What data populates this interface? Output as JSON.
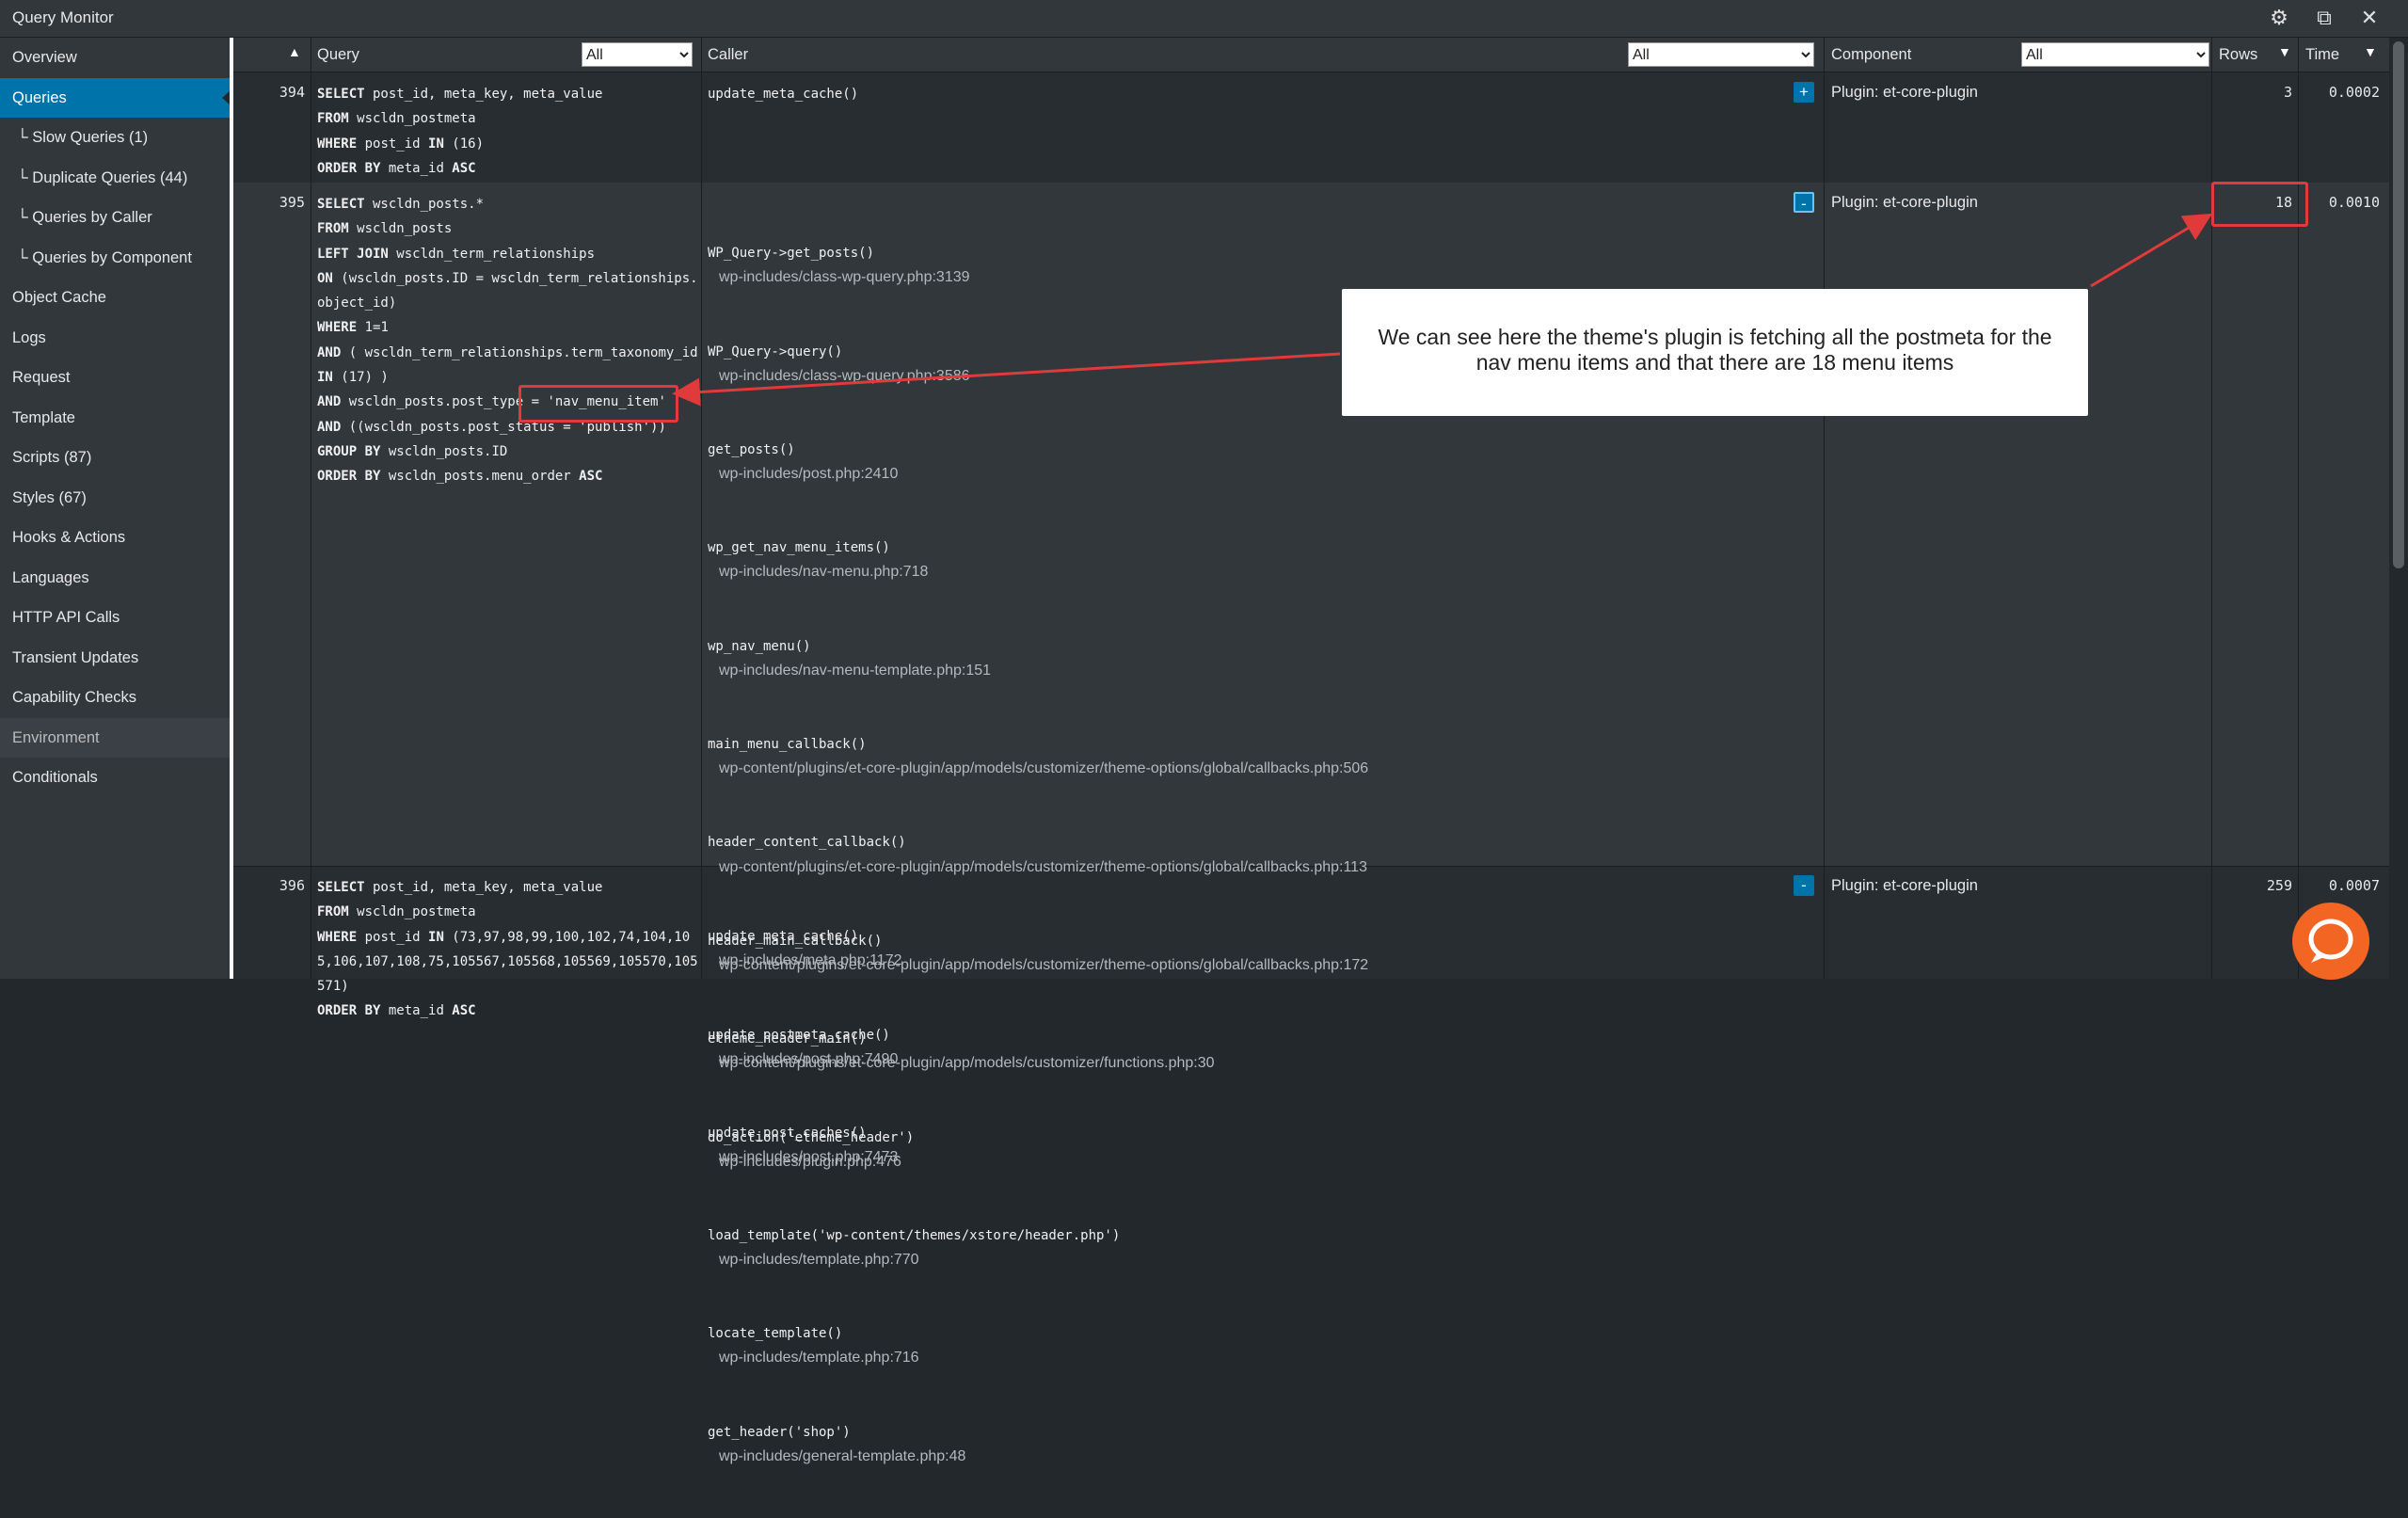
{
  "title": "Query Monitor",
  "sidebar": {
    "items": [
      {
        "label": "Overview"
      },
      {
        "label": "Queries"
      },
      {
        "label": "└ Slow Queries (1)"
      },
      {
        "label": "└ Duplicate Queries (44)"
      },
      {
        "label": "└ Queries by Caller"
      },
      {
        "label": "└ Queries by Component"
      },
      {
        "label": "Object Cache"
      },
      {
        "label": "Logs"
      },
      {
        "label": "Request"
      },
      {
        "label": "Template"
      },
      {
        "label": "Scripts (87)"
      },
      {
        "label": "Styles (67)"
      },
      {
        "label": "Hooks & Actions"
      },
      {
        "label": "Languages"
      },
      {
        "label": "HTTP API Calls"
      },
      {
        "label": "Transient Updates"
      },
      {
        "label": "Capability Checks"
      },
      {
        "label": "Environment"
      },
      {
        "label": "Conditionals"
      }
    ]
  },
  "header": {
    "query": "Query",
    "caller": "Caller",
    "component": "Component",
    "rows": "Rows",
    "time": "Time",
    "filter_all": "All"
  },
  "rows": [
    {
      "num": "394",
      "sql": [
        "SELECT post_id, meta_key, meta_value",
        "FROM wscldn_postmeta",
        "WHERE post_id IN (16)",
        "ORDER BY meta_id ASC"
      ],
      "callers": [
        {
          "fn": "update_meta_cache()"
        }
      ],
      "toggle": "+",
      "component": "Plugin: et-core-plugin",
      "rows": "3",
      "time": "0.0002"
    },
    {
      "num": "395",
      "sql": [
        "SELECT wscldn_posts.*",
        "FROM wscldn_posts",
        "LEFT JOIN wscldn_term_relationships",
        "ON (wscldn_posts.ID = wscldn_term_relationships.",
        "object_id)",
        "WHERE 1=1",
        "AND ( wscldn_term_relationships.term_taxonomy_id",
        "IN (17) )",
        "AND wscldn_posts.post_type = 'nav_menu_item'",
        "AND ((wscldn_posts.post_status = 'publish'))",
        "GROUP BY wscldn_posts.ID",
        "ORDER BY wscldn_posts.menu_order ASC"
      ],
      "callers": [
        {
          "fn": "WP_Query->get_posts()",
          "path": "wp-includes/class-wp-query.php:3139"
        },
        {
          "fn": "WP_Query->query()",
          "path": "wp-includes/class-wp-query.php:3586"
        },
        {
          "fn": "get_posts()",
          "path": "wp-includes/post.php:2410"
        },
        {
          "fn": "wp_get_nav_menu_items()",
          "path": "wp-includes/nav-menu.php:718"
        },
        {
          "fn": "wp_nav_menu()",
          "path": "wp-includes/nav-menu-template.php:151"
        },
        {
          "fn": "main_menu_callback()",
          "path": "wp-content/plugins/et-core-plugin/app/models/customizer/theme-options/global/callbacks.php:506"
        },
        {
          "fn": "header_content_callback()",
          "path": "wp-content/plugins/et-core-plugin/app/models/customizer/theme-options/global/callbacks.php:113"
        },
        {
          "fn": "header_main_callback()",
          "path": "wp-content/plugins/et-core-plugin/app/models/customizer/theme-options/global/callbacks.php:172"
        },
        {
          "fn": "etheme_header_main()",
          "path": "wp-content/plugins/et-core-plugin/app/models/customizer/functions.php:30"
        },
        {
          "fn": "do_action('etheme_header')",
          "path": "wp-includes/plugin.php:476"
        },
        {
          "fn": "load_template('wp-content/themes/xstore/header.php')",
          "path": "wp-includes/template.php:770"
        },
        {
          "fn": "locate_template()",
          "path": "wp-includes/template.php:716"
        },
        {
          "fn": "get_header('shop')",
          "path": "wp-includes/general-template.php:48"
        }
      ],
      "toggle": "-",
      "component": "Plugin: et-core-plugin",
      "rows": "18",
      "time": "0.0010"
    },
    {
      "num": "396",
      "sql": [
        "SELECT post_id, meta_key, meta_value",
        "FROM wscldn_postmeta",
        "WHERE post_id IN (73,97,98,99,100,102,74,104,10",
        "5,106,107,108,75,105567,105568,105569,105570,105",
        "571)",
        "ORDER BY meta_id ASC"
      ],
      "callers": [
        {
          "fn": "update_meta_cache()",
          "path": "wp-includes/meta.php:1172"
        },
        {
          "fn": "update_postmeta_cache()",
          "path": "wp-includes/post.php:7490"
        },
        {
          "fn": "update_post_caches()",
          "path": "wp-includes/post.php:7473"
        }
      ],
      "toggle": "-",
      "component": "Plugin: et-core-plugin",
      "rows": "259",
      "time": "0.0007"
    }
  ],
  "annotation": {
    "text": "We can see here the theme's plugin is fetching all the postmeta for the nav menu items and that there are 18 menu items"
  },
  "colors": {
    "accent": "#0073aa",
    "annotation_red": "#e03a3a",
    "chat": "#f26522"
  }
}
